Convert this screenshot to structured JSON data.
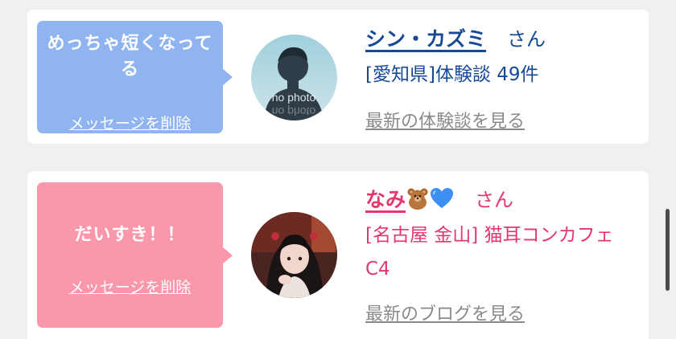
{
  "entries": [
    {
      "bubble_message": "めっちゃ短くなってる",
      "delete_label": "メッセージを削除",
      "avatar_caption": "no photo",
      "name": "シン・カズミ",
      "honorific": "さん",
      "info": "[愛知県]体験談 49件",
      "latest_link": "最新の体験談を見る",
      "colors": {
        "bubble": "#8fb4f0",
        "text": "#174a96"
      }
    },
    {
      "bubble_message": "だいすき！！",
      "delete_label": "メッセージを削除",
      "name": "なみ",
      "name_icons": [
        "teddy-bear-icon",
        "blue-heart-icon"
      ],
      "honorific": "さん",
      "info": "[名古屋 金山] 猫耳コンカフェ C4",
      "latest_link": "最新のブログを見る",
      "colors": {
        "bubble": "#fb97ab",
        "text": "#e2386d"
      }
    }
  ]
}
